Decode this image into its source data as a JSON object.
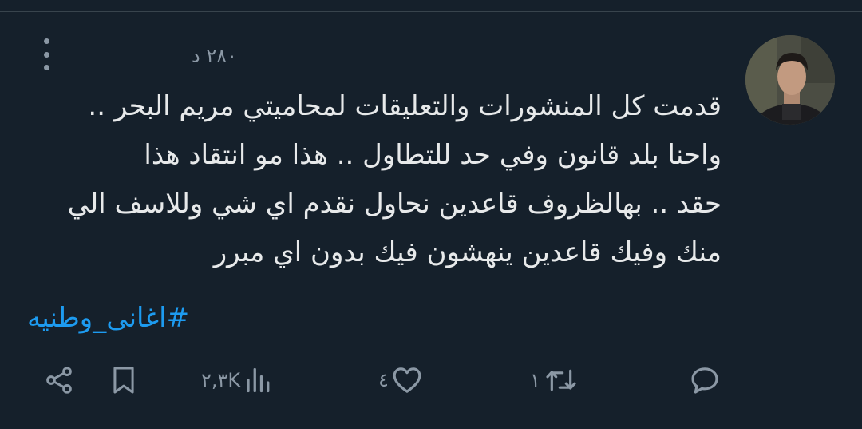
{
  "tweet": {
    "timestamp": "٢٨٠ د",
    "text_lines": [
      "قدمت كل المنشورات والتعليقات لمحاميتي مريم البحر ..",
      "واحنا بلد قانون وفي حد للتطاول .. هذا مو انتقاد هذا",
      "حقد .. بهالظروف قاعدين نحاول نقدم اي شي وللاسف الي",
      "منك وفيك قاعدين ينهشون فيك بدون اي مبرر"
    ],
    "hashtag": "#اغانى_وطنيه"
  },
  "actions": {
    "reply": {
      "icon": "reply-icon"
    },
    "retweet": {
      "icon": "retweet-icon",
      "count": "١"
    },
    "like": {
      "icon": "heart-icon",
      "count": "٤"
    },
    "views": {
      "icon": "views-icon",
      "count": "٢,٣K"
    },
    "bookmark": {
      "icon": "bookmark-icon"
    },
    "share": {
      "icon": "share-icon"
    }
  },
  "colors": {
    "background": "#15202b",
    "text": "#e7e9ea",
    "secondary": "#8b98a5",
    "link": "#1d9bf0"
  }
}
